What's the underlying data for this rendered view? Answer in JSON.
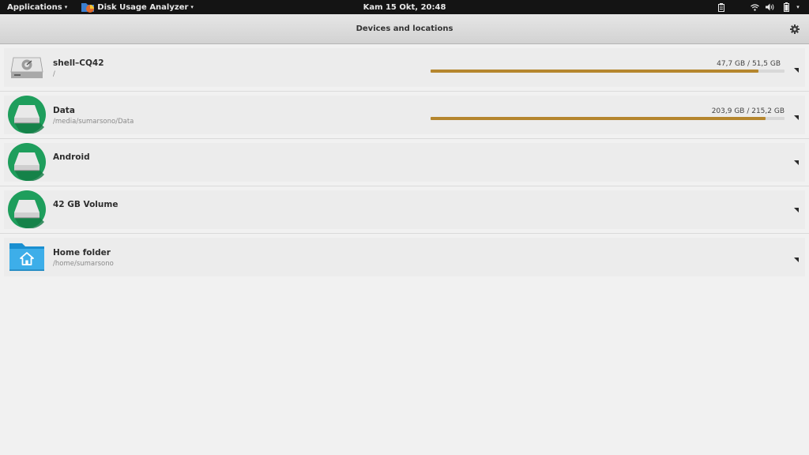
{
  "top_panel": {
    "applications_label": "Applications",
    "app_name": "Disk Usage Analyzer",
    "clock": "Kam 15 Okt, 20:48",
    "tray_icons": [
      "clipboard-icon",
      "wifi-icon",
      "volume-icon",
      "battery-icon",
      "chevron-down-icon"
    ]
  },
  "header": {
    "title": "Devices and locations",
    "settings_icon": "gear-icon"
  },
  "locations": [
    {
      "name": "shell–CQ42",
      "path": "/",
      "usage": "47,7 GB / 51,5 GB",
      "fill_fraction": 0.926,
      "icon": "hard-disk-icon"
    },
    {
      "name": "Data",
      "path": "/media/sumarsono/Data",
      "usage": "203,9 GB / 215,2 GB",
      "fill_fraction": 0.947,
      "icon": "drive-icon"
    },
    {
      "name": "Android",
      "path": "",
      "usage": "",
      "icon": "drive-icon"
    },
    {
      "name": "42 GB Volume",
      "path": "",
      "usage": "",
      "icon": "drive-icon"
    },
    {
      "name": "Home folder",
      "path": "/home/sumarsono",
      "usage": "",
      "icon": "home-folder-icon"
    }
  ],
  "colors": {
    "usage_bar_fill": "#b5862e",
    "drive_icon_green": "#1e9e5c",
    "folder_blue": "#3daee9"
  }
}
